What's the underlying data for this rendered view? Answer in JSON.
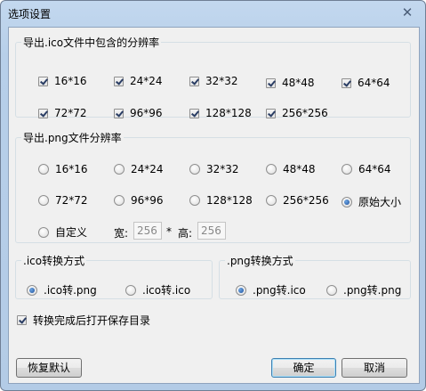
{
  "window": {
    "title": "选项设置",
    "close_glyph": "✕"
  },
  "ico_group": {
    "title": "导出.ico文件中包含的分辨率",
    "options": [
      {
        "label": "16*16",
        "checked": true
      },
      {
        "label": "24*24",
        "checked": true
      },
      {
        "label": "32*32",
        "checked": true
      },
      {
        "label": "48*48",
        "checked": true
      },
      {
        "label": "64*64",
        "checked": true
      },
      {
        "label": "72*72",
        "checked": true
      },
      {
        "label": "96*96",
        "checked": true
      },
      {
        "label": "128*128",
        "checked": true
      },
      {
        "label": "256*256",
        "checked": true
      }
    ]
  },
  "png_group": {
    "title": "导出.png文件分辨率",
    "options": [
      {
        "label": "16*16",
        "selected": false
      },
      {
        "label": "24*24",
        "selected": false
      },
      {
        "label": "32*32",
        "selected": false
      },
      {
        "label": "48*48",
        "selected": false
      },
      {
        "label": "64*64",
        "selected": false
      },
      {
        "label": "72*72",
        "selected": false
      },
      {
        "label": "96*96",
        "selected": false
      },
      {
        "label": "128*128",
        "selected": false
      },
      {
        "label": "256*256",
        "selected": false
      },
      {
        "label": "原始大小",
        "selected": true
      },
      {
        "label": "自定义",
        "selected": false
      }
    ],
    "custom": {
      "width_label": "宽:",
      "width_value": "256",
      "separator": "*",
      "height_label": "高:",
      "height_value": "256"
    }
  },
  "ico_convert": {
    "title": ".ico转换方式",
    "options": [
      {
        "label": ".ico转.png",
        "selected": true
      },
      {
        "label": ".ico转.ico",
        "selected": false
      }
    ]
  },
  "png_convert": {
    "title": ".png转换方式",
    "options": [
      {
        "label": ".png转.ico",
        "selected": true
      },
      {
        "label": ".png转.png",
        "selected": false
      }
    ]
  },
  "open_dir": {
    "label": "转换完成后打开保存目录",
    "checked": true
  },
  "buttons": {
    "restore": "恢复默认",
    "ok": "确定",
    "cancel": "取消"
  }
}
